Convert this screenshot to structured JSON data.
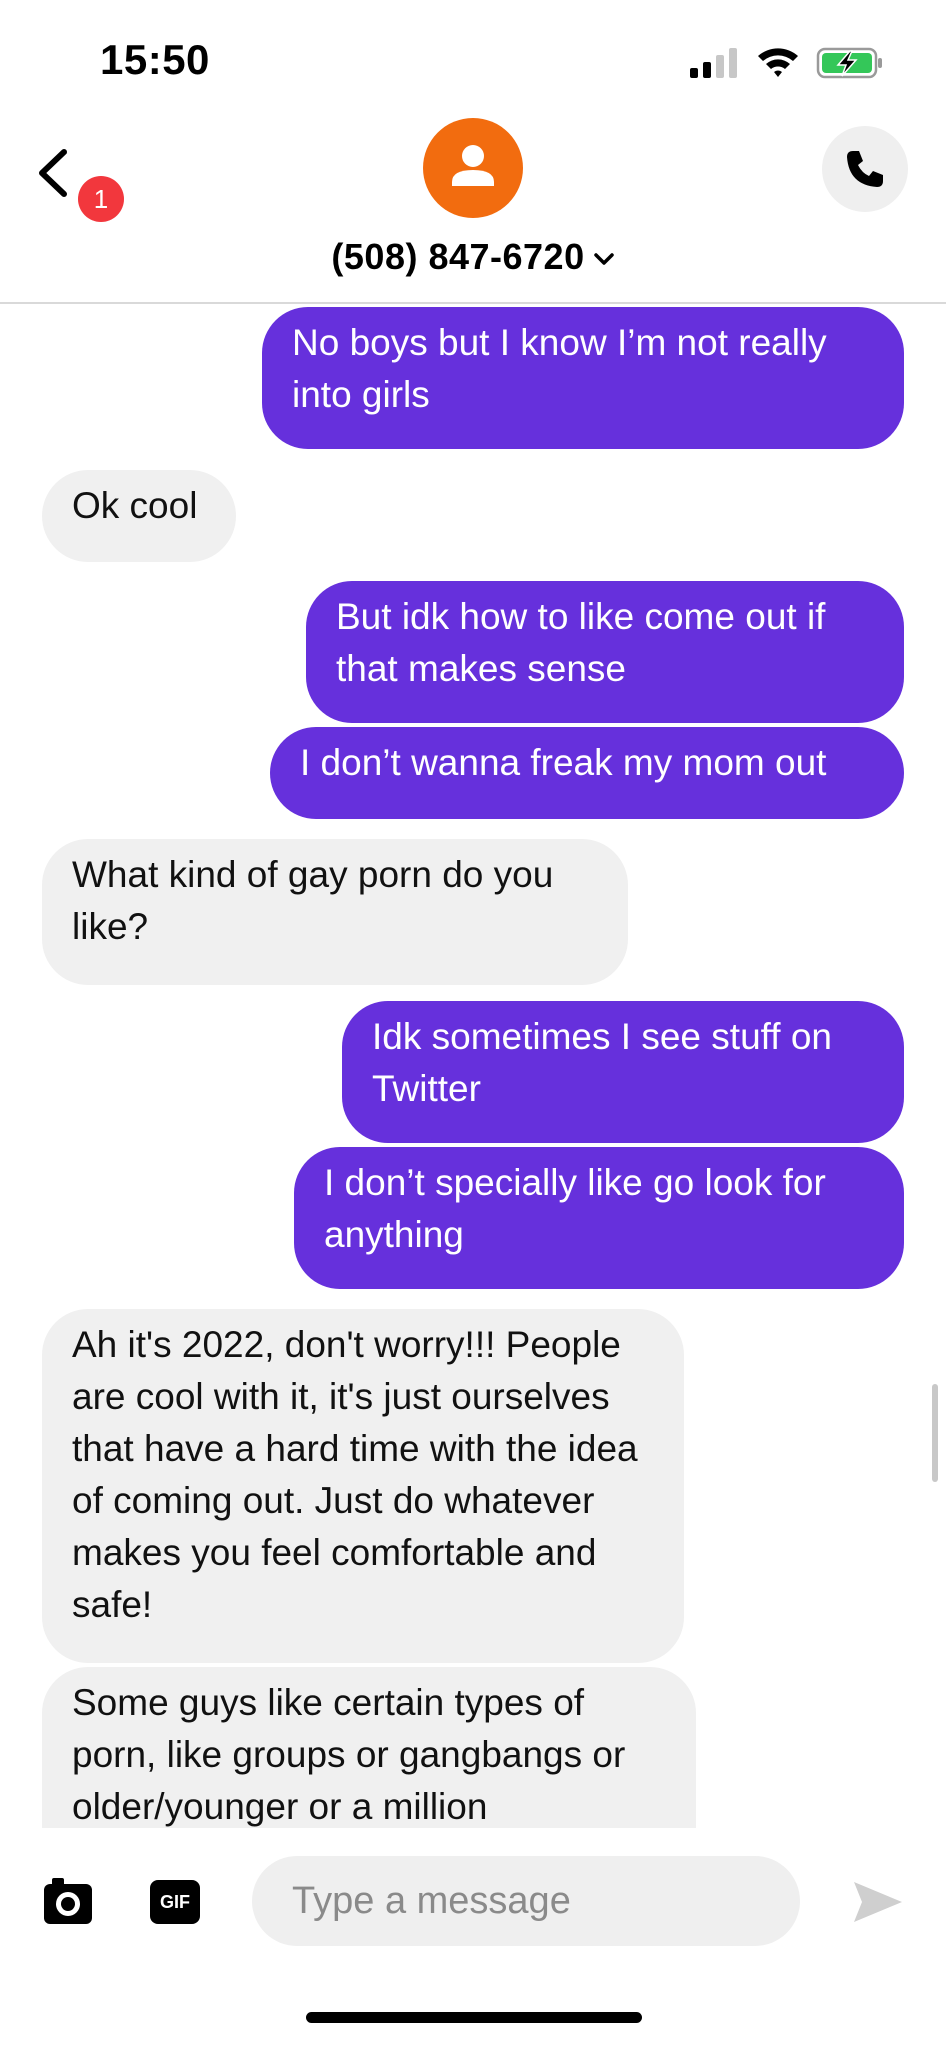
{
  "status_bar": {
    "time": "15:50"
  },
  "header": {
    "back_badge_count": "1",
    "contact_name": "(508) 847-6720"
  },
  "messages": [
    {
      "direction": "outgoing",
      "text": "No boys but I know I’m not really into girls"
    },
    {
      "direction": "incoming",
      "text": "Ok cool"
    },
    {
      "direction": "outgoing",
      "text": "But idk how to like come out if that makes sense"
    },
    {
      "direction": "outgoing",
      "text": "I don’t wanna freak my mom out"
    },
    {
      "direction": "incoming",
      "text": "What kind of gay porn do you like?"
    },
    {
      "direction": "outgoing",
      "text": "Idk sometimes I see stuff on Twitter"
    },
    {
      "direction": "outgoing",
      "text": "I don’t specially like go look for anything"
    },
    {
      "direction": "incoming",
      "text": "Ah it's 2022, don't worry!!! People are cool with it, it's just ourselves that have a hard time with the idea of coming out. Just do whatever makes you feel comfortable and safe!"
    },
    {
      "direction": "incoming",
      "text": "Some guys like certain types of porn, like groups or gangbangs or older/younger or a million"
    }
  ],
  "composer": {
    "gif_label": "GIF",
    "placeholder": "Type a message"
  },
  "colors": {
    "outgoing_bubble": "#6630dc",
    "incoming_bubble": "#f0f0f0",
    "avatar": "#f26c0f",
    "badge": "#f2373d",
    "battery_charge": "#34c759"
  },
  "icons": [
    "back-chevron-icon",
    "person-icon",
    "phone-icon",
    "chevron-down-icon",
    "camera-icon",
    "send-icon",
    "signal-icon",
    "wifi-icon",
    "battery-charging-icon"
  ]
}
